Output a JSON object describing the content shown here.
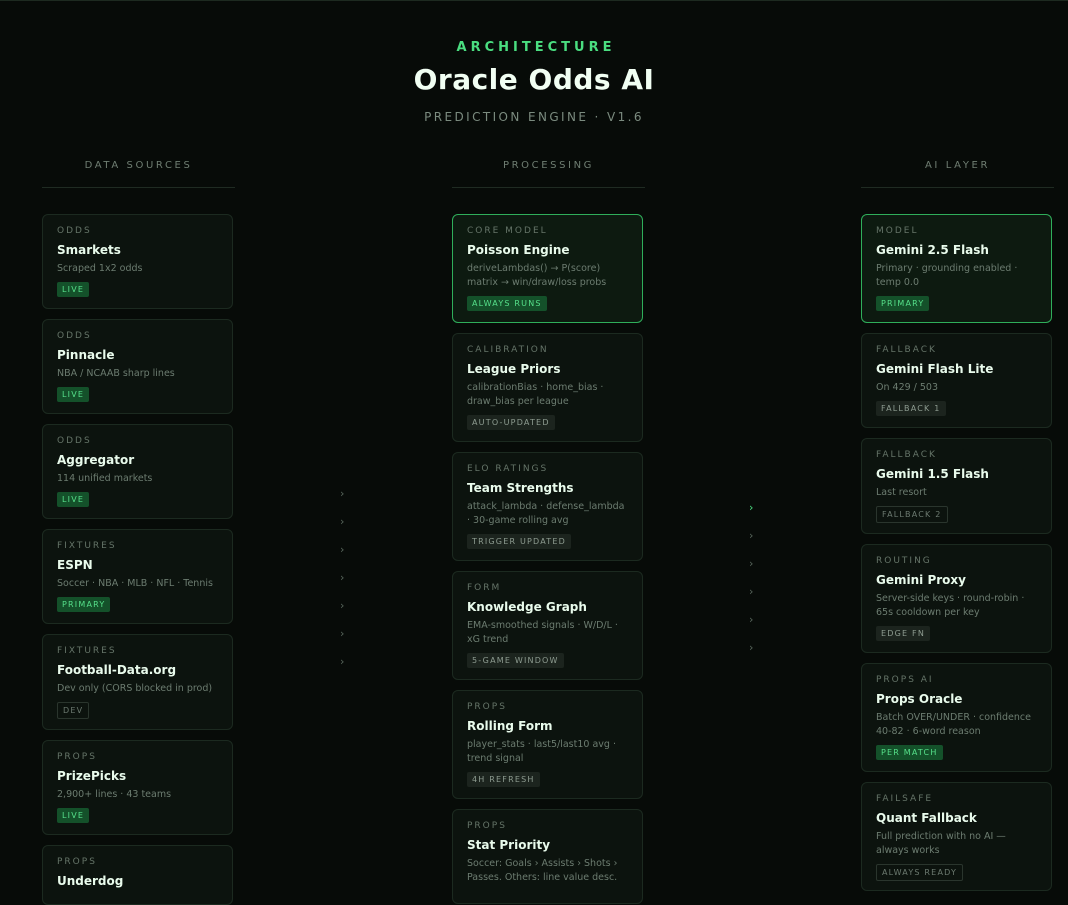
{
  "header": {
    "eyebrow": "ARCHITECTURE",
    "title": "Oracle Odds AI",
    "subtitle": "PREDICTION ENGINE · V1.6"
  },
  "columns": {
    "data_sources": {
      "title": "DATA SOURCES",
      "cards": [
        {
          "category": "ODDS",
          "name": "Smarkets",
          "desc": "Scraped 1x2 odds",
          "badge": "LIVE"
        },
        {
          "category": "ODDS",
          "name": "Pinnacle",
          "desc": "NBA / NCAAB sharp lines",
          "badge": "LIVE"
        },
        {
          "category": "ODDS",
          "name": "Aggregator",
          "desc": "114 unified markets",
          "badge": "LIVE"
        },
        {
          "category": "FIXTURES",
          "name": "ESPN",
          "desc": "Soccer · NBA · MLB · NFL · Tennis",
          "badge": "PRIMARY"
        },
        {
          "category": "FIXTURES",
          "name": "Football-Data.org",
          "desc": "Dev only (CORS blocked in prod)",
          "badge": "DEV"
        },
        {
          "category": "PROPS",
          "name": "PrizePicks",
          "desc": "2,900+ lines · 43 teams",
          "badge": "LIVE"
        },
        {
          "category": "PROPS",
          "name": "Underdog",
          "desc": "",
          "badge": ""
        }
      ]
    },
    "processing": {
      "title": "PROCESSING",
      "cards": [
        {
          "category": "CORE MODEL",
          "name": "Poisson Engine",
          "desc": "deriveLambdas() → P(score) matrix → win/draw/loss probs",
          "badge": "ALWAYS RUNS"
        },
        {
          "category": "CALIBRATION",
          "name": "League Priors",
          "desc": "calibrationBias · home_bias · draw_bias per league",
          "badge": "AUTO-UPDATED"
        },
        {
          "category": "ELO RATINGS",
          "name": "Team Strengths",
          "desc": "attack_lambda · defense_lambda · 30-game rolling avg",
          "badge": "TRIGGER UPDATED"
        },
        {
          "category": "FORM",
          "name": "Knowledge Graph",
          "desc": "EMA-smoothed signals · W/D/L · xG trend",
          "badge": "5-GAME WINDOW"
        },
        {
          "category": "PROPS",
          "name": "Rolling Form",
          "desc": "player_stats · last5/last10 avg · trend signal",
          "badge": "4H REFRESH"
        },
        {
          "category": "PROPS",
          "name": "Stat Priority",
          "desc": "Soccer: Goals › Assists › Shots › Passes. Others: line value desc.",
          "badge": ""
        }
      ]
    },
    "ai_layer": {
      "title": "AI LAYER",
      "cards": [
        {
          "category": "MODEL",
          "name": "Gemini 2.5 Flash",
          "desc": "Primary · grounding enabled · temp 0.0",
          "badge": "PRIMARY"
        },
        {
          "category": "FALLBACK",
          "name": "Gemini Flash Lite",
          "desc": "On 429 / 503",
          "badge": "FALLBACK 1"
        },
        {
          "category": "FALLBACK",
          "name": "Gemini 1.5 Flash",
          "desc": "Last resort",
          "badge": "FALLBACK 2"
        },
        {
          "category": "ROUTING",
          "name": "Gemini Proxy",
          "desc": "Server-side keys · round-robin · 65s cooldown per key",
          "badge": "EDGE FN"
        },
        {
          "category": "PROPS AI",
          "name": "Props Oracle",
          "desc": "Batch OVER/UNDER · confidence 40-82 · 6-word reason",
          "badge": "PER MATCH"
        },
        {
          "category": "FAILSAFE",
          "name": "Quant Fallback",
          "desc": "Full prediction with no AI — always works",
          "badge": "ALWAYS READY"
        }
      ]
    }
  },
  "arrows": {
    "glyph": "›"
  }
}
